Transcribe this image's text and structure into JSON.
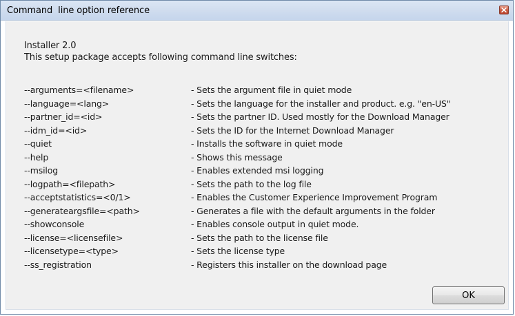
{
  "window": {
    "title": "Command  line option reference",
    "close_icon": "close-x-icon"
  },
  "message": {
    "line1": "Installer 2.0",
    "line2": "This setup package accepts following command line switches:"
  },
  "switches": [
    {
      "option": "--arguments=<filename>",
      "description": "- Sets the argument file in quiet mode"
    },
    {
      "option": "--language=<lang>",
      "description": "- Sets the language for the installer and product. e.g. \"en-US\""
    },
    {
      "option": "--partner_id=<id>",
      "description": "- Sets the partner ID. Used mostly for the Download Manager"
    },
    {
      "option": "--idm_id=<id>",
      "description": "- Sets the ID for the Internet Download Manager"
    },
    {
      "option": "--quiet",
      "description": "- Installs the software in quiet mode"
    },
    {
      "option": "--help",
      "description": "- Shows this message"
    },
    {
      "option": "--msilog",
      "description": "- Enables extended msi logging"
    },
    {
      "option": "--logpath=<filepath>",
      "description": "- Sets the path to the log file"
    },
    {
      "option": "--acceptstatistics=<0/1>",
      "description": "- Enables the Customer Experience Improvement Program"
    },
    {
      "option": "--generateargsfile=<path>",
      "description": "- Generates a file with the default arguments in the folder"
    },
    {
      "option": "--showconsole",
      "description": "- Enables console output in quiet mode."
    },
    {
      "option": "--license=<licensefile>",
      "description": "- Sets the path to the license file"
    },
    {
      "option": "--licensetype=<type>",
      "description": "- Sets the license type"
    },
    {
      "option": "--ss_registration",
      "description": "- Registers this installer on the download page"
    }
  ],
  "buttons": {
    "ok_label": "OK"
  },
  "colors": {
    "titlebar": "#cfdcee",
    "close_button": "#c95a40",
    "client_background": "#f0f0f0"
  }
}
